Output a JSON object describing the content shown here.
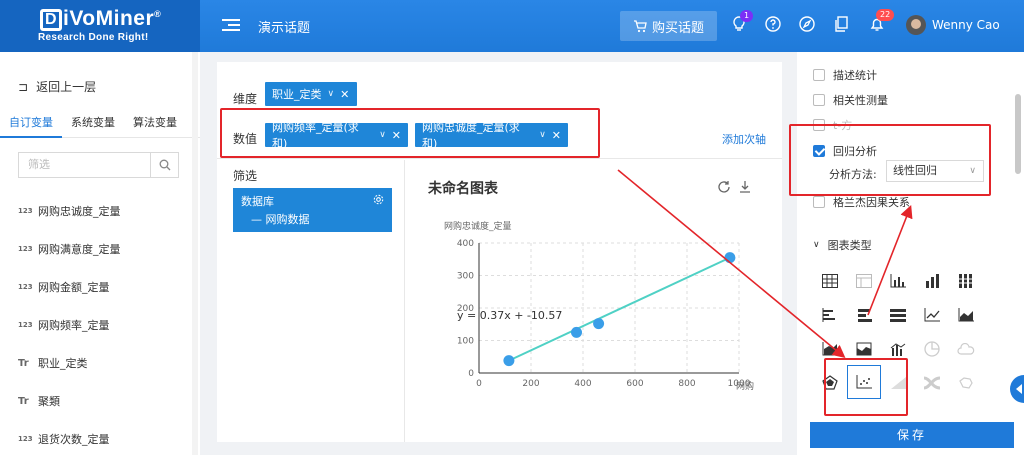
{
  "header": {
    "brand": "iVoMiner",
    "brand_mark": "D",
    "registered": "®",
    "tagline": "Research Done Right!",
    "topic": "演示话题",
    "buy_button": "购买话题",
    "hint_badge": "1",
    "notify_badge": "22",
    "username": "Wenny Cao"
  },
  "left": {
    "back": "返回上一层",
    "tabs": [
      "自订变量",
      "系统变量",
      "算法变量"
    ],
    "filter_placeholder": "筛选",
    "variables": [
      {
        "type": "123",
        "name": "网购忠诚度_定量"
      },
      {
        "type": "123",
        "name": "网购满意度_定量"
      },
      {
        "type": "123",
        "name": "网购金额_定量"
      },
      {
        "type": "123",
        "name": "网购频率_定量"
      },
      {
        "type": "Tr",
        "name": "职业_定类"
      },
      {
        "type": "Tr",
        "name": "聚類"
      },
      {
        "type": "123",
        "name": "退货次数_定量"
      }
    ]
  },
  "main": {
    "dimension_label": "维度",
    "dimension_tag": "职业_定类",
    "value_label": "数值",
    "value_tags": [
      "网购频率_定量(求和)",
      "网购忠诚度_定量(求和)"
    ],
    "add_axis": "添加次轴",
    "filter_title": "筛选",
    "db_title": "数据库",
    "db_item": "— 网购数据",
    "chart_title": "未命名图表"
  },
  "chart_data": {
    "type": "scatter",
    "ylabel": "网购忠诚度_定量",
    "xlabel": "网购",
    "xlim": [
      0,
      1000
    ],
    "ylim": [
      0,
      400
    ],
    "x_ticks": [
      0,
      200,
      400,
      600,
      800,
      1000
    ],
    "y_ticks": [
      0,
      100,
      200,
      300,
      400
    ],
    "points": [
      {
        "x": 115,
        "y": 38
      },
      {
        "x": 375,
        "y": 125
      },
      {
        "x": 460,
        "y": 152
      },
      {
        "x": 965,
        "y": 355
      }
    ],
    "trend_line": {
      "x": [
        115,
        965
      ],
      "y": [
        38,
        355
      ]
    },
    "equation": "y = 0.37x + -10.57",
    "grid": true,
    "point_color": "#3a9ee8",
    "line_color": "#4fd1c5"
  },
  "right": {
    "options": [
      {
        "label": "描述统计",
        "checked": false
      },
      {
        "label": "相关性测量",
        "checked": false
      },
      {
        "label": "t-方",
        "checked": false
      },
      {
        "label": "回归分析",
        "checked": true
      },
      {
        "label": "格兰杰因果关系",
        "checked": false
      }
    ],
    "method_label": "分析方法:",
    "method_value": "线性回归",
    "chart_type_title": "图表类型",
    "save": "保存"
  },
  "colors": {
    "primary": "#1f7ad9",
    "annotation": "#e3252a"
  }
}
